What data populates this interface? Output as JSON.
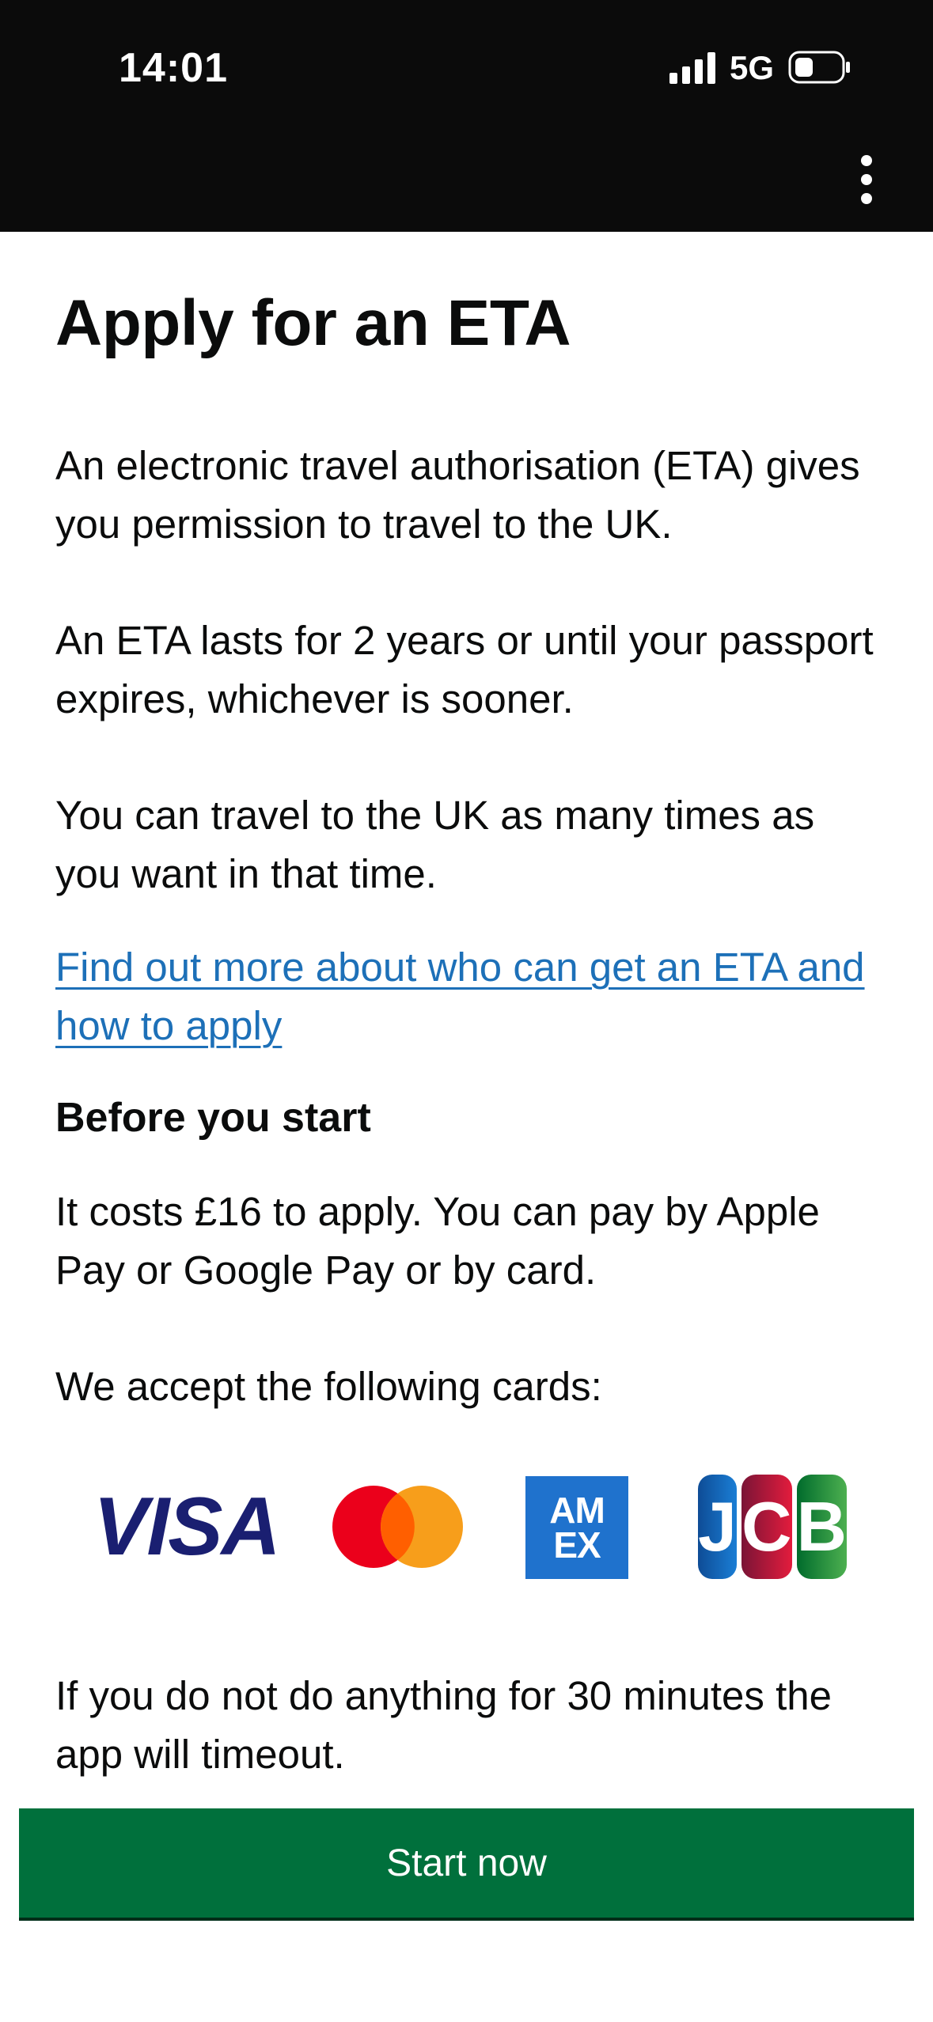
{
  "status_bar": {
    "time": "14:01",
    "network": "5G",
    "icons": [
      "signal-icon",
      "battery-icon"
    ]
  },
  "header": {
    "menu_icon": "vertical-dots-icon"
  },
  "page": {
    "title": "Apply for an ETA",
    "paragraphs": [
      "An electronic travel authorisation (ETA) gives you permission to travel to the UK.",
      "An ETA lasts for 2 years or until your passport expires, whichever is sooner.",
      "You can travel to the UK as many times as you want in that time."
    ],
    "link_text": "Find out more about who can get an ETA and how to apply",
    "section_heading": "Before you start",
    "cost_text": "It costs £16 to apply. You can pay by Apple Pay or Google Pay or by card.",
    "cards_text": "We accept the following cards:",
    "cards": [
      "VISA",
      "AM",
      "EX",
      "J",
      "C",
      "B"
    ],
    "timeout_text": "If you do not do anything for 30 minutes the app will timeout."
  },
  "actions": {
    "start_label": "Start now"
  },
  "colors": {
    "link": "#1d70b8",
    "button": "#00703c",
    "header": "#0b0b0b"
  }
}
